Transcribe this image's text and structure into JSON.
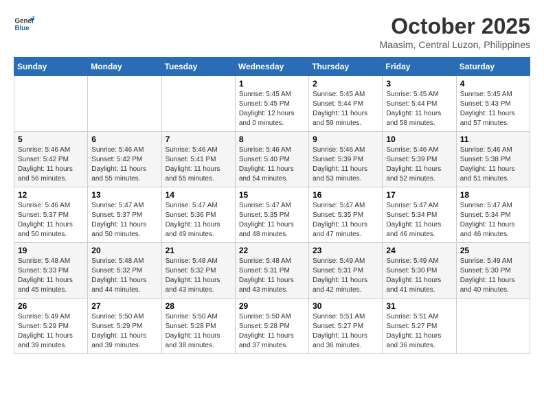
{
  "header": {
    "logo_line1": "General",
    "logo_line2": "Blue",
    "title": "October 2025",
    "subtitle": "Maasim, Central Luzon, Philippines"
  },
  "weekdays": [
    "Sunday",
    "Monday",
    "Tuesday",
    "Wednesday",
    "Thursday",
    "Friday",
    "Saturday"
  ],
  "weeks": [
    [
      {
        "day": "",
        "info": ""
      },
      {
        "day": "",
        "info": ""
      },
      {
        "day": "",
        "info": ""
      },
      {
        "day": "1",
        "info": "Sunrise: 5:45 AM\nSunset: 5:45 PM\nDaylight: 12 hours\nand 0 minutes."
      },
      {
        "day": "2",
        "info": "Sunrise: 5:45 AM\nSunset: 5:44 PM\nDaylight: 11 hours\nand 59 minutes."
      },
      {
        "day": "3",
        "info": "Sunrise: 5:45 AM\nSunset: 5:44 PM\nDaylight: 11 hours\nand 58 minutes."
      },
      {
        "day": "4",
        "info": "Sunrise: 5:45 AM\nSunset: 5:43 PM\nDaylight: 11 hours\nand 57 minutes."
      }
    ],
    [
      {
        "day": "5",
        "info": "Sunrise: 5:46 AM\nSunset: 5:42 PM\nDaylight: 11 hours\nand 56 minutes."
      },
      {
        "day": "6",
        "info": "Sunrise: 5:46 AM\nSunset: 5:42 PM\nDaylight: 11 hours\nand 55 minutes."
      },
      {
        "day": "7",
        "info": "Sunrise: 5:46 AM\nSunset: 5:41 PM\nDaylight: 11 hours\nand 55 minutes."
      },
      {
        "day": "8",
        "info": "Sunrise: 5:46 AM\nSunset: 5:40 PM\nDaylight: 11 hours\nand 54 minutes."
      },
      {
        "day": "9",
        "info": "Sunrise: 5:46 AM\nSunset: 5:39 PM\nDaylight: 11 hours\nand 53 minutes."
      },
      {
        "day": "10",
        "info": "Sunrise: 5:46 AM\nSunset: 5:39 PM\nDaylight: 11 hours\nand 52 minutes."
      },
      {
        "day": "11",
        "info": "Sunrise: 5:46 AM\nSunset: 5:38 PM\nDaylight: 11 hours\nand 51 minutes."
      }
    ],
    [
      {
        "day": "12",
        "info": "Sunrise: 5:46 AM\nSunset: 5:37 PM\nDaylight: 11 hours\nand 50 minutes."
      },
      {
        "day": "13",
        "info": "Sunrise: 5:47 AM\nSunset: 5:37 PM\nDaylight: 11 hours\nand 50 minutes."
      },
      {
        "day": "14",
        "info": "Sunrise: 5:47 AM\nSunset: 5:36 PM\nDaylight: 11 hours\nand 49 minutes."
      },
      {
        "day": "15",
        "info": "Sunrise: 5:47 AM\nSunset: 5:35 PM\nDaylight: 11 hours\nand 48 minutes."
      },
      {
        "day": "16",
        "info": "Sunrise: 5:47 AM\nSunset: 5:35 PM\nDaylight: 11 hours\nand 47 minutes."
      },
      {
        "day": "17",
        "info": "Sunrise: 5:47 AM\nSunset: 5:34 PM\nDaylight: 11 hours\nand 46 minutes."
      },
      {
        "day": "18",
        "info": "Sunrise: 5:47 AM\nSunset: 5:34 PM\nDaylight: 11 hours\nand 46 minutes."
      }
    ],
    [
      {
        "day": "19",
        "info": "Sunrise: 5:48 AM\nSunset: 5:33 PM\nDaylight: 11 hours\nand 45 minutes."
      },
      {
        "day": "20",
        "info": "Sunrise: 5:48 AM\nSunset: 5:32 PM\nDaylight: 11 hours\nand 44 minutes."
      },
      {
        "day": "21",
        "info": "Sunrise: 5:48 AM\nSunset: 5:32 PM\nDaylight: 11 hours\nand 43 minutes."
      },
      {
        "day": "22",
        "info": "Sunrise: 5:48 AM\nSunset: 5:31 PM\nDaylight: 11 hours\nand 43 minutes."
      },
      {
        "day": "23",
        "info": "Sunrise: 5:49 AM\nSunset: 5:31 PM\nDaylight: 11 hours\nand 42 minutes."
      },
      {
        "day": "24",
        "info": "Sunrise: 5:49 AM\nSunset: 5:30 PM\nDaylight: 11 hours\nand 41 minutes."
      },
      {
        "day": "25",
        "info": "Sunrise: 5:49 AM\nSunset: 5:30 PM\nDaylight: 11 hours\nand 40 minutes."
      }
    ],
    [
      {
        "day": "26",
        "info": "Sunrise: 5:49 AM\nSunset: 5:29 PM\nDaylight: 11 hours\nand 39 minutes."
      },
      {
        "day": "27",
        "info": "Sunrise: 5:50 AM\nSunset: 5:29 PM\nDaylight: 11 hours\nand 39 minutes."
      },
      {
        "day": "28",
        "info": "Sunrise: 5:50 AM\nSunset: 5:28 PM\nDaylight: 11 hours\nand 38 minutes."
      },
      {
        "day": "29",
        "info": "Sunrise: 5:50 AM\nSunset: 5:28 PM\nDaylight: 11 hours\nand 37 minutes."
      },
      {
        "day": "30",
        "info": "Sunrise: 5:51 AM\nSunset: 5:27 PM\nDaylight: 11 hours\nand 36 minutes."
      },
      {
        "day": "31",
        "info": "Sunrise: 5:51 AM\nSunset: 5:27 PM\nDaylight: 11 hours\nand 36 minutes."
      },
      {
        "day": "",
        "info": ""
      }
    ]
  ]
}
